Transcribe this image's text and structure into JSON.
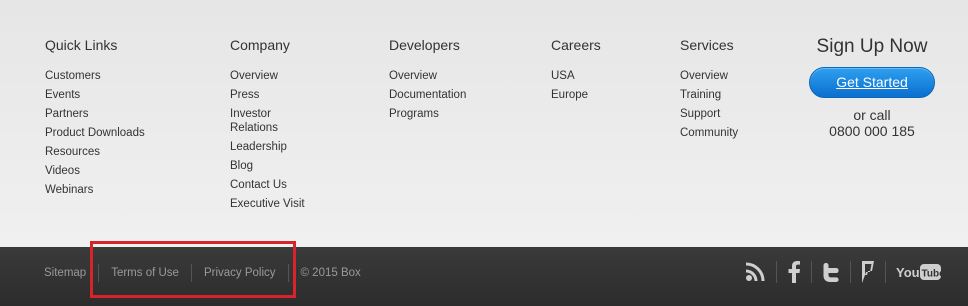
{
  "columns": [
    {
      "heading": "Quick Links",
      "items": [
        "Customers",
        "Events",
        "Partners",
        "Product Downloads",
        "Resources",
        "Videos",
        "Webinars"
      ]
    },
    {
      "heading": "Company",
      "items": [
        "Overview",
        "Press",
        "Investor Relations",
        "Leadership",
        "Blog",
        "Contact Us",
        "Executive Visit"
      ]
    },
    {
      "heading": "Developers",
      "items": [
        "Overview",
        "Documentation",
        "Programs"
      ]
    },
    {
      "heading": "Careers",
      "items": [
        "USA",
        "Europe"
      ]
    },
    {
      "heading": "Services",
      "items": [
        "Overview",
        "Training",
        "Support",
        "Community"
      ]
    }
  ],
  "signup": {
    "title": "Sign Up Now",
    "button_label": "Get Started",
    "or_call": "or call",
    "phone": "0800 000 185"
  },
  "bottom_bar": {
    "sitemap": "Sitemap",
    "terms": "Terms of Use",
    "privacy": "Privacy Policy",
    "copyright": "© 2015 Box"
  },
  "social_icons": [
    "rss-icon",
    "facebook-icon",
    "twitter-icon",
    "foursquare-icon",
    "youtube-icon"
  ],
  "social_youtube_text": "YouTube",
  "colors": {
    "button_start": "#2ea0f0",
    "button_end": "#0a6fcf",
    "highlight": "#d9232a",
    "bottom_bar": "#333333"
  }
}
